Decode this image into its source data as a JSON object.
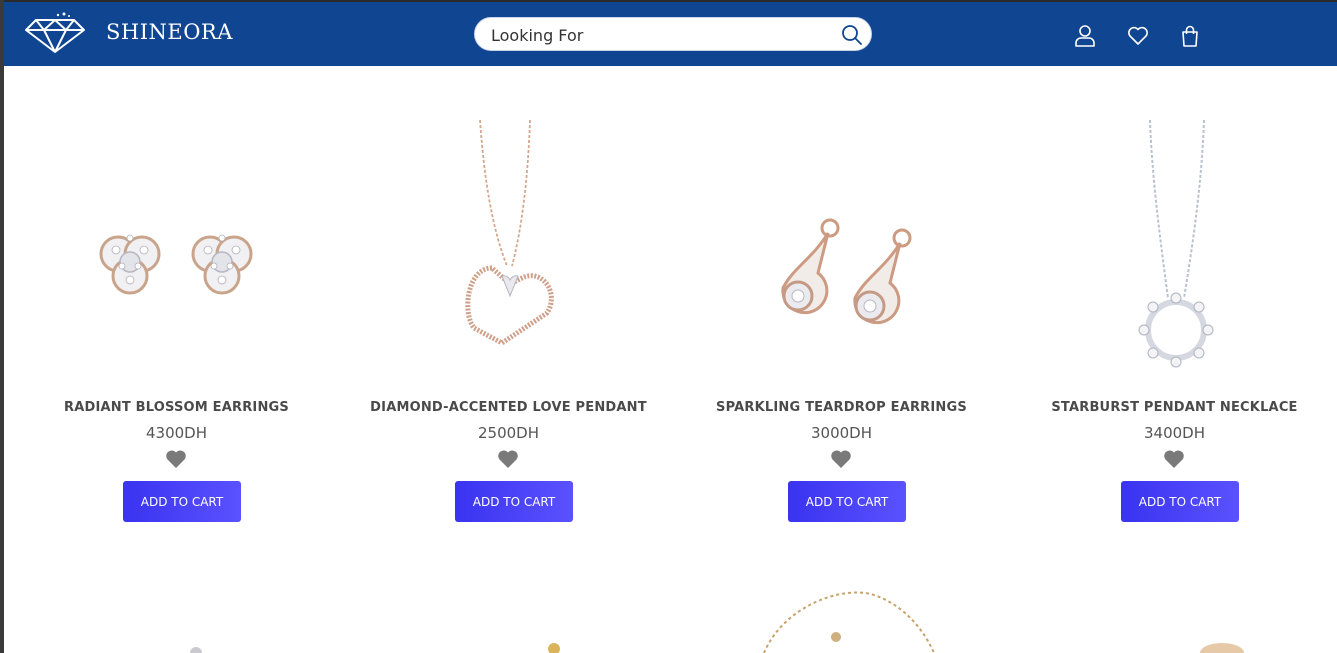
{
  "header": {
    "brand": "SHINEORA",
    "search_placeholder": "Looking For",
    "icons": [
      "diamond-logo-icon",
      "search-icon",
      "user-icon",
      "heart-icon",
      "shopping-bag-icon"
    ]
  },
  "products": [
    {
      "name": "RADIANT BLOSSOM EARRINGS",
      "price": "4300DH",
      "button": "ADD TO CART",
      "image": "earrings"
    },
    {
      "name": "DIAMOND-ACCENTED LOVE PENDANT",
      "price": "2500DH",
      "button": "ADD TO CART",
      "image": "heart-pendant"
    },
    {
      "name": "SPARKLING TEARDROP EARRINGS",
      "price": "3000DH",
      "button": "ADD TO CART",
      "image": "teardrop-earrings"
    },
    {
      "name": "STARBURST PENDANT NECKLACE",
      "price": "3400DH",
      "button": "ADD TO CART",
      "image": "starburst-necklace"
    }
  ],
  "colors": {
    "header_bg": "#0f4591",
    "button_start": "#3a33f0",
    "button_end": "#5a52ff",
    "heart": "#7a7a7a"
  }
}
